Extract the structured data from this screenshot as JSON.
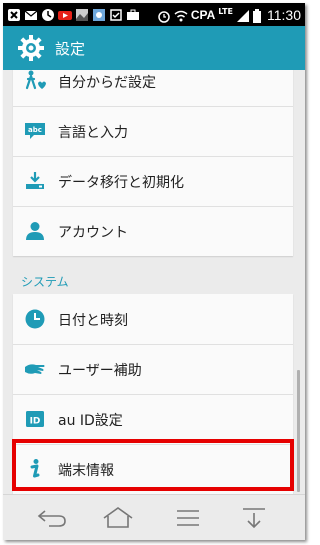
{
  "status_bar": {
    "carrier_text": "CPA",
    "network_type": "LTE",
    "time": "11:30"
  },
  "action_bar": {
    "title": "設定",
    "icon": "settings-gear-icon"
  },
  "colors": {
    "accent": "#1f9bb6",
    "highlight_border": "#e60000"
  },
  "main": {
    "card1_items": [
      {
        "label": "自分からだ設定",
        "icon": "body-settings-icon"
      },
      {
        "label": "言語と入力",
        "icon": "keyboard-abc-icon"
      },
      {
        "label": "データ移行と初期化",
        "icon": "download-data-icon"
      },
      {
        "label": "アカウント",
        "icon": "account-person-icon"
      }
    ],
    "section_header": "システム",
    "card2_items": [
      {
        "label": "日付と時刻",
        "icon": "clock-icon"
      },
      {
        "label": "ユーザー補助",
        "icon": "accessibility-hand-icon"
      },
      {
        "label": "au ID設定",
        "icon": "id-card-icon"
      },
      {
        "label": "端末情報",
        "icon": "info-icon",
        "highlighted": true
      }
    ]
  },
  "nav_bar": {
    "buttons": [
      "back-icon",
      "home-icon",
      "menu-icon",
      "scroll-down-icon"
    ]
  }
}
